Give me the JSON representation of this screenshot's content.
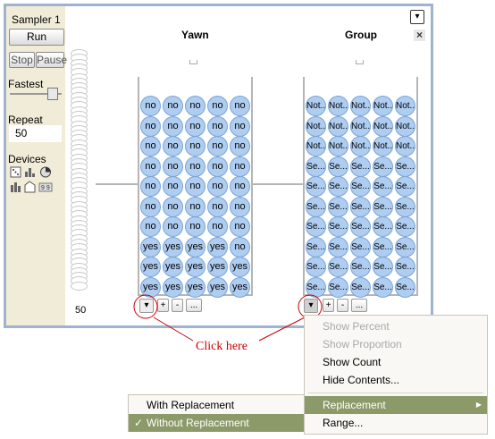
{
  "window": {
    "title": "Sampler 1"
  },
  "sidebar": {
    "run_label": "Run",
    "stop_label": "Stop",
    "pause_label": "Pause",
    "speed_label": "Fastest",
    "repeat_label": "Repeat",
    "repeat_value": "50",
    "devices_label": "Devices",
    "device_icons": [
      "dice-icon",
      "histogram-icon",
      "spinner-icon",
      "bars-icon",
      "urn-icon",
      "counter-icon"
    ]
  },
  "stack": {
    "count_label": "50"
  },
  "columns": [
    {
      "title": "Yawn",
      "rows": [
        [
          "no",
          "no",
          "no",
          "no",
          "no"
        ],
        [
          "no",
          "no",
          "no",
          "no",
          "no"
        ],
        [
          "no",
          "no",
          "no",
          "no",
          "no"
        ],
        [
          "no",
          "no",
          "no",
          "no",
          "no"
        ],
        [
          "no",
          "no",
          "no",
          "no",
          "no"
        ],
        [
          "no",
          "no",
          "no",
          "no",
          "no"
        ],
        [
          "no",
          "no",
          "no",
          "no",
          "no"
        ],
        [
          "yes",
          "yes",
          "yes",
          "yes",
          "no"
        ],
        [
          "yes",
          "yes",
          "yes",
          "yes",
          "yes"
        ],
        [
          "yes",
          "yes",
          "yes",
          "yes",
          "yes"
        ]
      ]
    },
    {
      "title": "Group",
      "rows": [
        [
          "Not...",
          "Not...",
          "Not...",
          "Not...",
          "Not..."
        ],
        [
          "Not...",
          "Not...",
          "Not...",
          "Not...",
          "Not..."
        ],
        [
          "Not...",
          "Not...",
          "Not...",
          "Not...",
          "Not..."
        ],
        [
          "Se...",
          "Se...",
          "Se...",
          "Se...",
          "Se..."
        ],
        [
          "Se...",
          "Se...",
          "Se...",
          "Se...",
          "Se..."
        ],
        [
          "Se...",
          "Se...",
          "Se...",
          "Se...",
          "Se..."
        ],
        [
          "Se...",
          "Se...",
          "Se...",
          "Se...",
          "Se..."
        ],
        [
          "Se...",
          "Se...",
          "Se...",
          "Se...",
          "Se..."
        ],
        [
          "Se...",
          "Se...",
          "Se...",
          "Se...",
          "Se..."
        ],
        [
          "Se...",
          "Se...",
          "Se...",
          "Se...",
          "Se..."
        ]
      ]
    }
  ],
  "device_controls": {
    "menu_glyph": "▾",
    "add": "+",
    "remove": "-",
    "more": "..."
  },
  "annotation": {
    "text": "Click here",
    "color": "#cc0000"
  },
  "context_menu": {
    "items": [
      {
        "label": "Show Percent",
        "enabled": false
      },
      {
        "label": "Show Proportion",
        "enabled": false
      },
      {
        "label": "Show Count",
        "enabled": true
      },
      {
        "label": "Hide Contents...",
        "enabled": true
      },
      {
        "label": "Replacement",
        "enabled": true,
        "highlighted": true,
        "submenu": true
      },
      {
        "label": "Range...",
        "enabled": true
      }
    ],
    "submenu_arrow": "▶"
  },
  "replacement_submenu": {
    "items": [
      {
        "label": "With Replacement",
        "checked": false
      },
      {
        "label": "Without Replacement",
        "checked": true
      }
    ],
    "check_glyph": "✓"
  },
  "colors": {
    "frame_border": "#9fb3cf",
    "sidebar_bg": "#f1ecd8",
    "ball_fill": "#aecdf0",
    "menu_highlight": "#8c9a6a"
  }
}
